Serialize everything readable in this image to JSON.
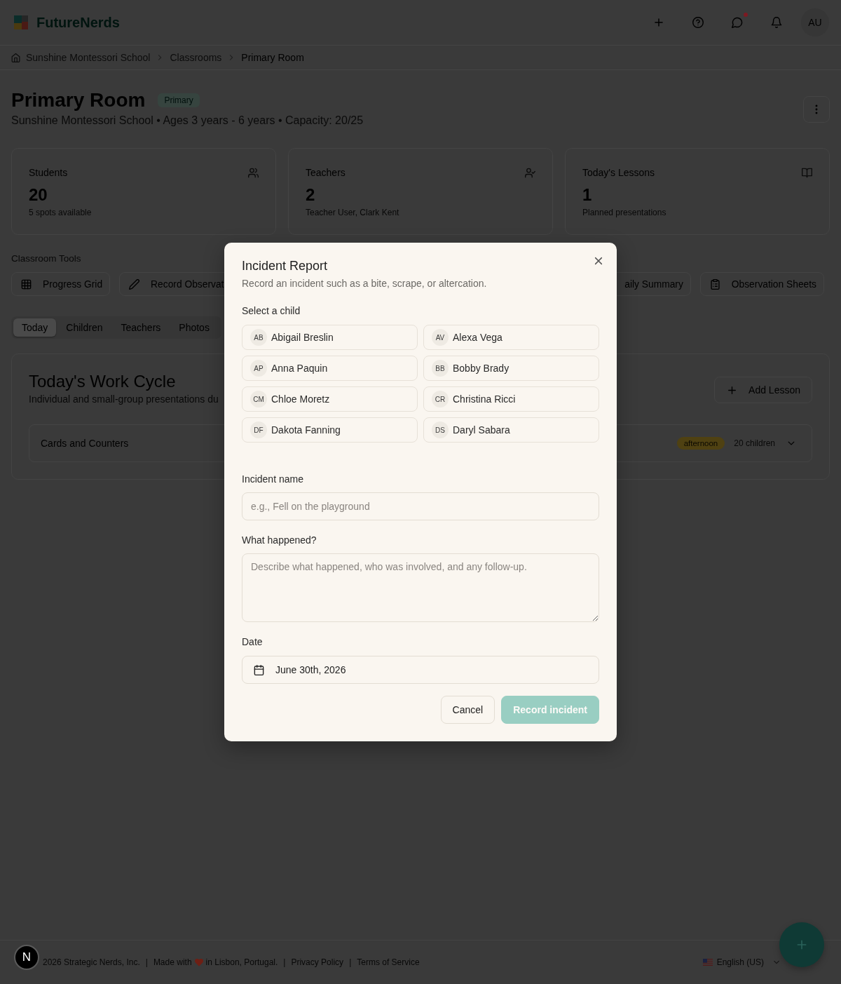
{
  "header": {
    "brand": "FutureNerds",
    "messages_unread": true,
    "avatar": "AU"
  },
  "breadcrumb": [
    {
      "label": "Sunshine Montessori School",
      "current": false
    },
    {
      "label": "Classrooms",
      "current": false
    },
    {
      "label": "Primary Room",
      "current": true
    }
  ],
  "page": {
    "title": "Primary Room",
    "badge": "Primary",
    "subtitle": "Sunshine Montessori School • Ages 3 years - 6 years • Capacity: 20/25"
  },
  "stats": [
    {
      "kind": "students",
      "label": "Students",
      "value": "20",
      "note": "5 spots available"
    },
    {
      "kind": "teachers",
      "label": "Teachers",
      "value": "2",
      "note": "Teacher User, Clark Kent"
    },
    {
      "kind": "lessons",
      "label": "Today's Lessons",
      "value": "1",
      "note": "Planned presentations"
    }
  ],
  "tools": {
    "title": "Classroom Tools",
    "items": [
      {
        "kind": "progress_grid",
        "label": "Progress Grid"
      },
      {
        "kind": "record_observation",
        "label": "Record Observat"
      },
      {
        "kind": "daily_summary",
        "label": "aily Summary"
      },
      {
        "kind": "observation_sheets",
        "label": "Observation Sheets"
      }
    ]
  },
  "tabs": [
    {
      "label": "Today",
      "selected": true
    },
    {
      "label": "Children",
      "selected": false
    },
    {
      "label": "Teachers",
      "selected": false
    },
    {
      "label": "Photos",
      "selected": false
    }
  ],
  "work_cycle": {
    "title": "Today's Work Cycle",
    "subtitle": "Individual and small-group presentations du",
    "add_button": "Add Lesson",
    "lessons": [
      {
        "name": "Cards and Counters",
        "period": "afternoon",
        "count": "20 children",
        "expanded": false
      }
    ]
  },
  "dialog": {
    "title": "Incident Report",
    "description": "Record an incident such as a bite, scrape, or altercation.",
    "child_label": "Select a child",
    "children": [
      {
        "initials": "AB",
        "name": "Abigail Breslin",
        "selected": false
      },
      {
        "initials": "AV",
        "name": "Alexa Vega",
        "selected": false
      },
      {
        "initials": "AP",
        "name": "Anna Paquin",
        "selected": false
      },
      {
        "initials": "BB",
        "name": "Bobby Brady",
        "selected": false
      },
      {
        "initials": "CM",
        "name": "Chloe Moretz",
        "selected": false
      },
      {
        "initials": "CR",
        "name": "Christina Ricci",
        "selected": false
      },
      {
        "initials": "DF",
        "name": "Dakota Fanning",
        "selected": false
      },
      {
        "initials": "DS",
        "name": "Daryl Sabara",
        "selected": false
      }
    ],
    "fields": [
      {
        "kind": "text",
        "label": "Incident name",
        "placeholder": "e.g., Fell on the playground"
      },
      {
        "kind": "textarea",
        "label": "What happened?",
        "placeholder": "Describe what happened, who was involved, and any follow-up."
      },
      {
        "kind": "date",
        "label": "Date",
        "value": "June 30th, 2026"
      }
    ],
    "buttons": [
      {
        "kind": "secondary",
        "label": "Cancel",
        "disabled": false
      },
      {
        "kind": "primary",
        "label": "Record incident",
        "disabled": true
      }
    ]
  },
  "footer": {
    "items": [
      {
        "kind": "text",
        "text": "2026 Strategic Nerds, Inc."
      },
      {
        "kind": "sep",
        "text": "|"
      },
      {
        "kind": "made_with",
        "before": "Made with",
        "after": "in Lisbon, Portugal."
      },
      {
        "kind": "sep",
        "text": "|"
      },
      {
        "kind": "link",
        "text": "Privacy Policy"
      },
      {
        "kind": "sep",
        "text": "|"
      },
      {
        "kind": "link",
        "text": "Terms of Service"
      }
    ],
    "language": "English (US)"
  },
  "dev_indicator": {
    "label": "N"
  }
}
